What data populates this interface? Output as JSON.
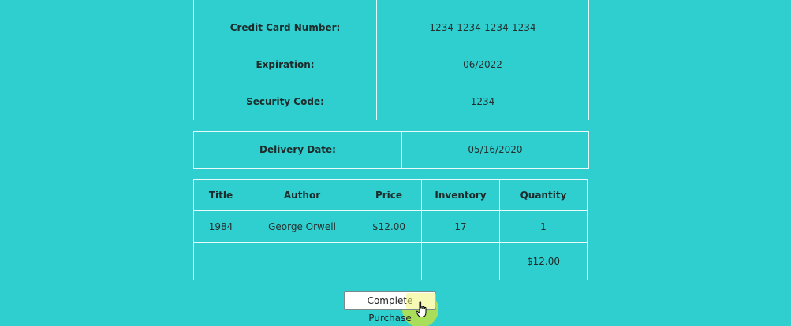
{
  "payment": {
    "rows": [
      {
        "label": "",
        "value": ""
      },
      {
        "label": "Credit Card Number:",
        "value": "1234-1234-1234-1234"
      },
      {
        "label": "Expiration:",
        "value": "06/2022"
      },
      {
        "label": "Security Code:",
        "value": "1234"
      }
    ]
  },
  "delivery": {
    "label": "Delivery Date:",
    "value": "05/16/2020"
  },
  "order": {
    "headers": [
      "Title",
      "Author",
      "Price",
      "Inventory",
      "Quantity"
    ],
    "items": [
      {
        "title": "1984",
        "author": "George Orwell",
        "price": "$12.00",
        "inventory": "17",
        "quantity": "1"
      }
    ],
    "total": "$12.00"
  },
  "actions": {
    "complete_label": "Complete Purchase"
  },
  "colors": {
    "background": "#30cfcf",
    "border": "#e9fbfb",
    "click_highlight": "#bee146"
  },
  "icons": {
    "cursor": "hand-pointer-icon"
  }
}
